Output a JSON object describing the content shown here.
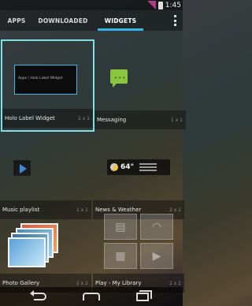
{
  "status": {
    "time": "1:45"
  },
  "tabs": [
    {
      "label": "APPS"
    },
    {
      "label": "DOWNLOADED"
    },
    {
      "label": "WIDGETS"
    }
  ],
  "widgets": [
    {
      "label": "Holo Label Widget",
      "dims": "2 x 1",
      "preview_text": "Apps \\ Holo Label Widget",
      "selected": true
    },
    {
      "label": "Messaging",
      "dims": "1 x 1"
    },
    {
      "label": "Music playlist",
      "dims": "1 x 1"
    },
    {
      "label": "News & Weather",
      "dims": "2 x 1",
      "temp": "64°"
    },
    {
      "label": "Photo Gallery",
      "dims": "2 x 2"
    },
    {
      "label": "Play - My Library",
      "dims": "2 x 2"
    }
  ],
  "colors": {
    "accent": "#33b5e5",
    "selection": "#7fe0e6",
    "notification": "#b23a8a"
  }
}
